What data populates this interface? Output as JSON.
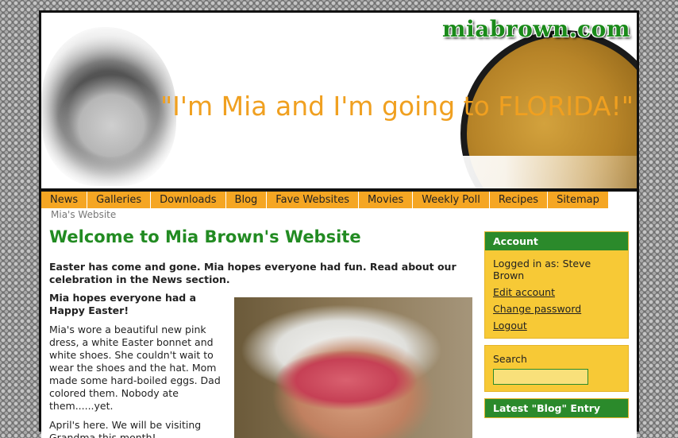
{
  "header": {
    "logo_text": "miabrown.com",
    "tagline": "\"I'm Mia and I'm going to FLORIDA!\""
  },
  "nav": {
    "items": [
      {
        "label": "News"
      },
      {
        "label": "Galleries"
      },
      {
        "label": "Downloads"
      },
      {
        "label": "Blog"
      },
      {
        "label": "Fave Websites"
      },
      {
        "label": "Movies"
      },
      {
        "label": "Weekly Poll"
      },
      {
        "label": "Recipes"
      },
      {
        "label": "Sitemap"
      }
    ]
  },
  "breadcrumb": "Mia's Website",
  "main": {
    "title": "Welcome to Mia Brown's Website",
    "intro": "Easter has come and gone. Mia hopes everyone had fun. Read about our celebration in the News section.",
    "easter_heading": "Mia hopes everyone had a Happy Easter!",
    "easter_body": "Mia's wore a beautiful new pink dress, a white Easter bonnet and white shoes. She couldn't wait to wear the shoes and the hat. Mom made some hard-boiled eggs. Dad colored them. Nobody ate them......yet.",
    "april_text": "April's here. We will be visiting Grandma this month!"
  },
  "sidebar": {
    "account": {
      "title": "Account",
      "logged_in": "Logged in as: Steve Brown",
      "links": [
        "Edit account",
        "Change password",
        "Logout"
      ]
    },
    "search": {
      "label": "Search",
      "value": ""
    },
    "latest_blog": {
      "title": "Latest \"Blog\" Entry"
    }
  },
  "colors": {
    "brand_green": "#228b22",
    "nav_orange": "#f5a623",
    "sidebar_yellow": "#f7c936",
    "tagline_orange": "#f0a020"
  }
}
